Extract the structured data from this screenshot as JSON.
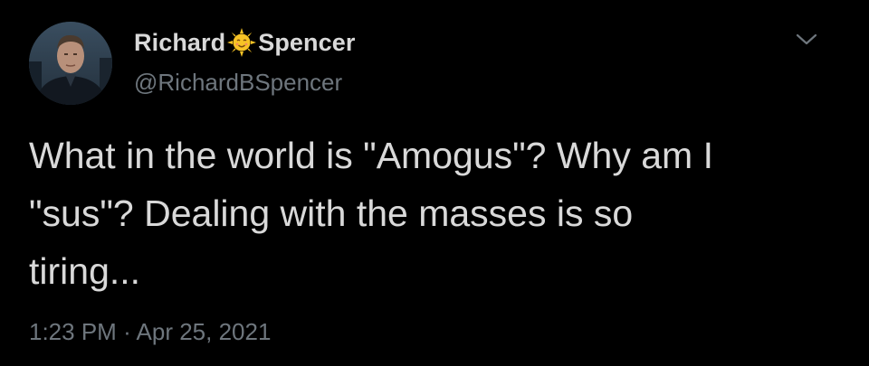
{
  "tweet": {
    "display_name_first": "Richard",
    "display_name_last": "Spencer",
    "display_name_emoji": "sun-with-face-icon",
    "handle": "@RichardBSpencer",
    "text_line_1": "What in the world is \"Amogus\"? Why am I",
    "text_line_2": "\"sus\"? Dealing with the masses is so",
    "text_line_3": "tiring...",
    "time": "1:23 PM",
    "separator": "·",
    "date": "Apr 25, 2021",
    "menu_icon": "chevron-down-icon"
  },
  "colors": {
    "background": "#000000",
    "primary_text": "#d9d9d9",
    "secondary_text": "#6e767d",
    "emoji_sun": "#f7c325"
  }
}
